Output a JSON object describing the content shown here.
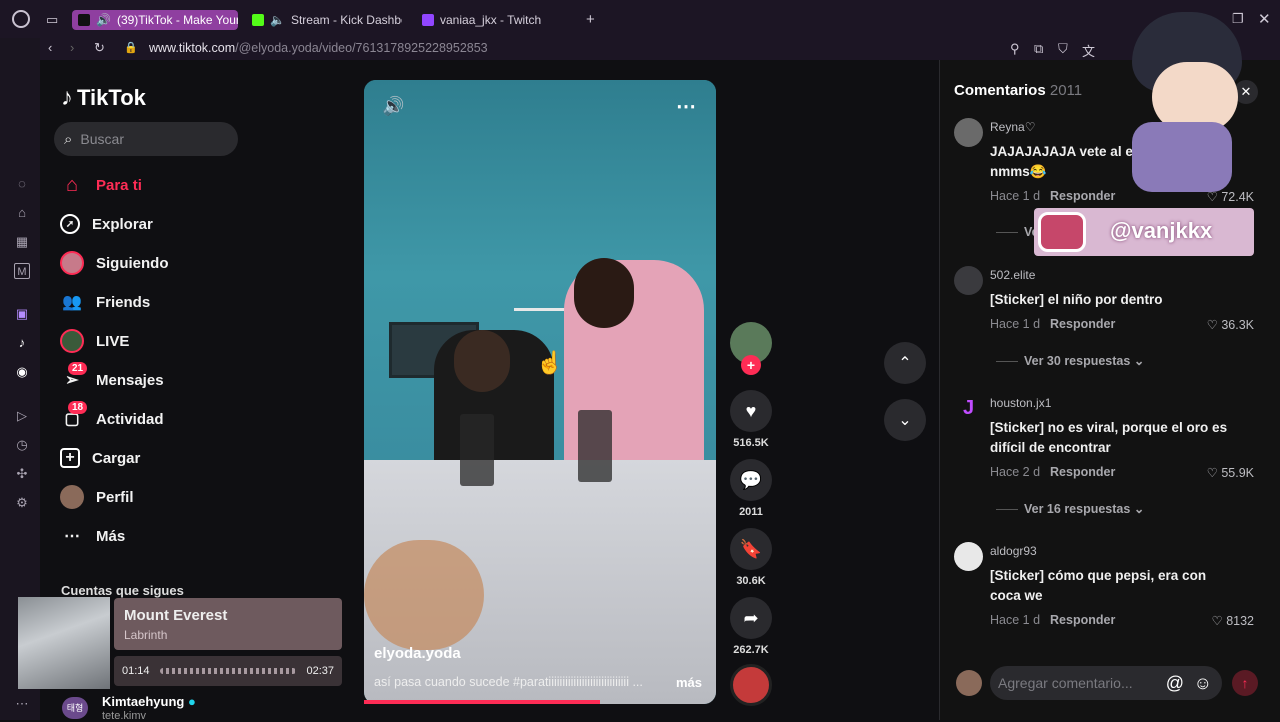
{
  "browser": {
    "tabs": [
      {
        "label": "(39)TikTok - Make Your",
        "active": true,
        "icon": "tiktok-icon"
      },
      {
        "label": "Stream - Kick Dashboard",
        "active": false,
        "icon": "kick-icon"
      },
      {
        "label": "vaniaa_jkx - Twitch",
        "active": false,
        "icon": "twitch-icon"
      }
    ],
    "url_domain": "www.tiktok.com",
    "url_path": "/@elyoda.yoda/video/7613178925228952853"
  },
  "sidebar": {
    "logo": "TikTok",
    "search_placeholder": "Buscar",
    "items": [
      {
        "label": "Para ti",
        "icon": "home-icon",
        "active": true
      },
      {
        "label": "Explorar",
        "icon": "compass-icon"
      },
      {
        "label": "Siguiendo",
        "icon": "following-avatar-icon"
      },
      {
        "label": "Friends",
        "icon": "friends-icon"
      },
      {
        "label": "LIVE",
        "icon": "live-icon"
      },
      {
        "label": "Mensajes",
        "icon": "messages-icon",
        "badge": "21"
      },
      {
        "label": "Actividad",
        "icon": "activity-icon",
        "badge": "18"
      },
      {
        "label": "Cargar",
        "icon": "upload-icon"
      },
      {
        "label": "Perfil",
        "icon": "profile-avatar-icon"
      },
      {
        "label": "Más",
        "icon": "more-icon"
      }
    ],
    "following_heading": "Cuentas que sigues",
    "following_user": "Kimtaehyung",
    "following_handle": "tete.kimv",
    "following_avatar_text": "태형"
  },
  "music": {
    "song": "Mount Everest",
    "artist": "Labrinth",
    "current": "01:14",
    "total": "02:37"
  },
  "video": {
    "username": "elyoda.yoda",
    "description": "así pasa cuando sucede #paratiiiiiiiiiiiiiiiiiiiiiiiiiiiii ...",
    "more": "más",
    "progress": 0.67
  },
  "actions": {
    "likes": "516.5K",
    "comments": "2011",
    "saves": "30.6K",
    "shares": "262.7K"
  },
  "comments_panel": {
    "title": "Comentarios",
    "count": "2011",
    "input_placeholder": "Agregar comentario...",
    "items": [
      {
        "user": "Reyna♡",
        "text": "JAJAJAJAJA vete al                   eso la lagrima nmms😂",
        "time": "Hace 1 d",
        "reply": "Responder",
        "likes": "72.4K",
        "replies": "Ve"
      },
      {
        "user": "502.elite",
        "text": "[Sticker] el niño por dentro",
        "time": "Hace 1 d",
        "reply": "Responder",
        "likes": "36.3K",
        "replies": "Ver 30 respuestas"
      },
      {
        "user": "houston.jx1",
        "text": "[Sticker] no es viral, porque el oro es difícil de encontrar",
        "time": "Hace 2 d",
        "reply": "Responder",
        "likes": "55.9K",
        "replies": "Ver 16 respuestas"
      },
      {
        "user": "aldogr93",
        "text": "[Sticker] cómo que pepsi, era con coca we",
        "time": "Hace 1 d",
        "reply": "Responder",
        "likes": "8132"
      }
    ]
  },
  "overlay": {
    "instagram_handle": "@vanjkkx"
  },
  "colors": {
    "accent": "#fe2c55",
    "tab_active": "#8f3fa0",
    "panel_bg": "#121212"
  }
}
